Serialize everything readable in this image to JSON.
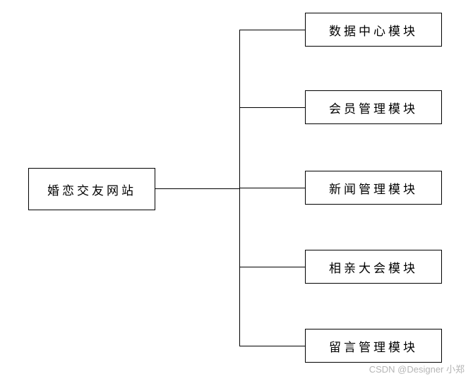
{
  "diagram": {
    "root": {
      "label": "婚恋交友网站"
    },
    "children": [
      {
        "label": "数据中心模块"
      },
      {
        "label": "会员管理模块"
      },
      {
        "label": "新闻管理模块"
      },
      {
        "label": "相亲大会模块"
      },
      {
        "label": "留言管理模块"
      }
    ]
  },
  "watermark": "CSDN @Designer 小郑"
}
